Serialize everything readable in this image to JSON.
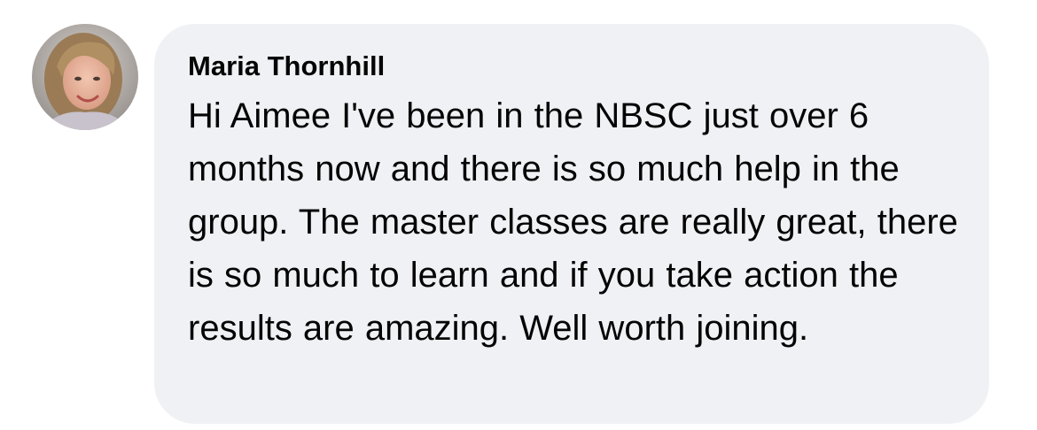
{
  "comment": {
    "author_name": "Maria Thornhill",
    "avatar": "profile-photo",
    "text": "Hi Aimee I've been in the NBSC just over 6 months now and there is so much help in the group. The master classes are really great, there is so much to learn and if you take action the results are amazing. Well worth joining.",
    "bubble_color": "#f0f1f5",
    "text_color": "#050505"
  }
}
